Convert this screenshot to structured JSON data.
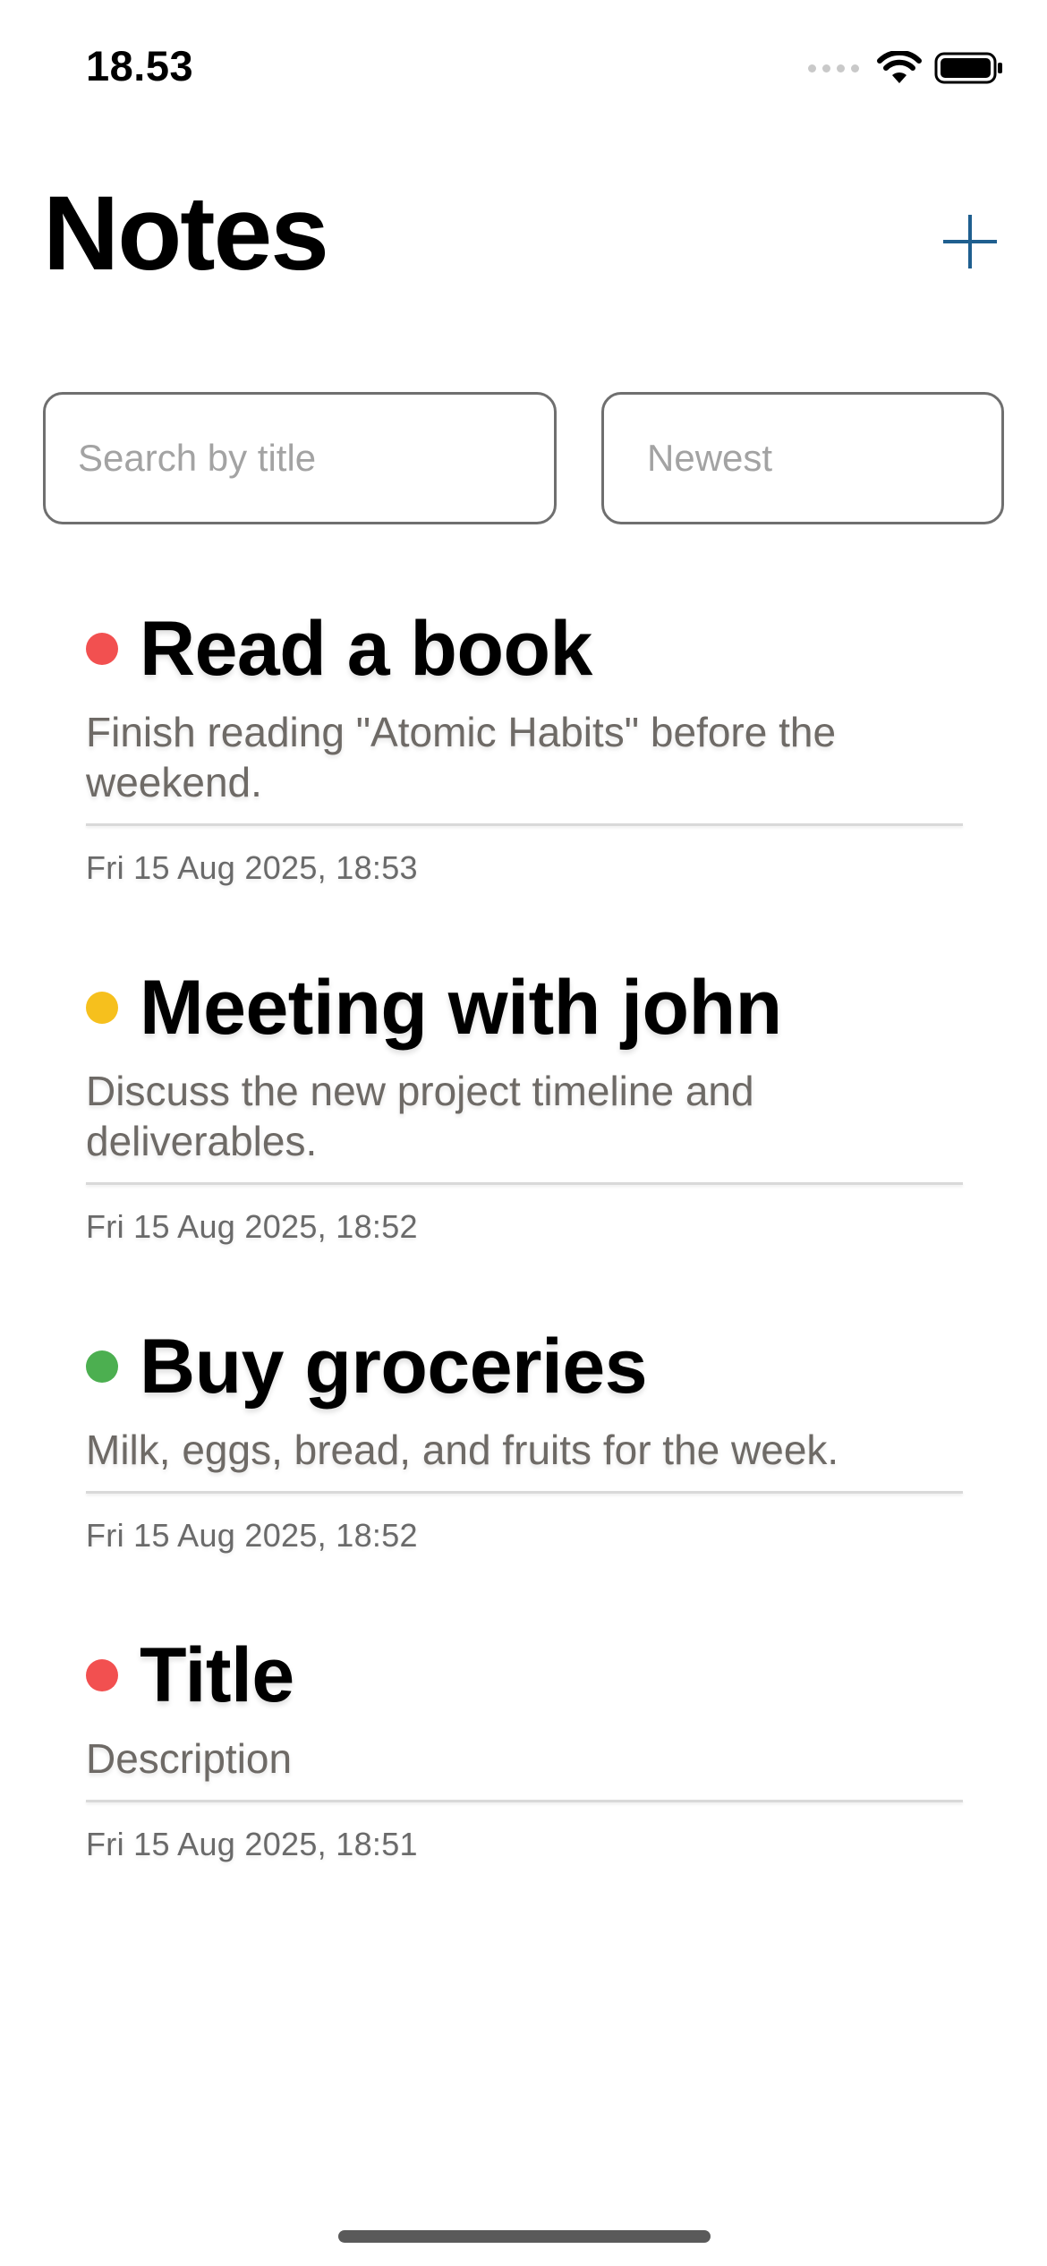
{
  "status_bar": {
    "time": "18.53"
  },
  "header": {
    "title": "Notes",
    "add_icon": "plus-icon",
    "accent_color": "#1f5f8f"
  },
  "search": {
    "placeholder": "Search by title",
    "value": ""
  },
  "sort": {
    "selected": "Newest"
  },
  "notes": [
    {
      "title": "Read a book",
      "description": "Finish reading \"Atomic Habits\" before the weekend.",
      "date": "Fri 15 Aug 2025, 18:53",
      "priority_color": "#f25050"
    },
    {
      "title": "Meeting with john",
      "description": "Discuss the new project timeline and deliverables.",
      "date": "Fri 15 Aug 2025, 18:52",
      "priority_color": "#f6c01d"
    },
    {
      "title": "Buy groceries",
      "description": "Milk, eggs, bread, and fruits for the week.",
      "date": "Fri 15 Aug 2025, 18:52",
      "priority_color": "#4caf50"
    },
    {
      "title": "Title",
      "description": "Description",
      "date": "Fri 15 Aug 2025, 18:51",
      "priority_color": "#f25050"
    }
  ]
}
